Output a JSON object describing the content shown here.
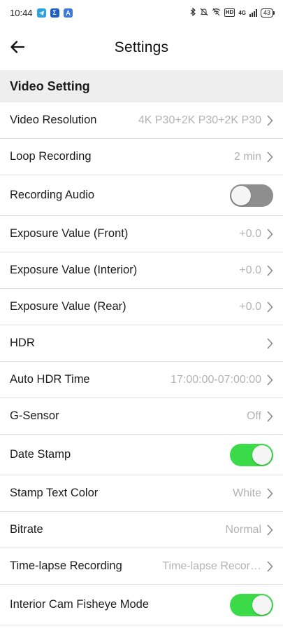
{
  "status_bar": {
    "time": "10:44",
    "battery": "43",
    "network": "4G",
    "hd_badge": "HD",
    "app_icons": [
      "telegram-icon",
      "sigma-app-icon",
      "antenna-app-icon"
    ]
  },
  "header": {
    "title": "Settings",
    "back_icon": "arrow-left-icon"
  },
  "section": {
    "title": "Video Setting"
  },
  "colors": {
    "toggle_on": "#3ada48",
    "toggle_off": "#8e8e8e",
    "value_text": "#b3b3b3",
    "section_bg": "#eeeeee"
  },
  "settings": [
    {
      "label": "Video Resolution",
      "value": "4K P30+2K P30+2K P30",
      "control": "chevron"
    },
    {
      "label": "Loop Recording",
      "value": "2 min",
      "control": "chevron"
    },
    {
      "label": "Recording Audio",
      "value": "",
      "control": "toggle",
      "state": "off"
    },
    {
      "label": "Exposure Value (Front)",
      "value": "+0.0",
      "control": "chevron"
    },
    {
      "label": "Exposure Value (Interior)",
      "value": "+0.0",
      "control": "chevron"
    },
    {
      "label": "Exposure Value (Rear)",
      "value": "+0.0",
      "control": "chevron"
    },
    {
      "label": "HDR",
      "value": "",
      "control": "chevron"
    },
    {
      "label": "Auto HDR Time",
      "value": "17:00:00-07:00:00",
      "control": "chevron"
    },
    {
      "label": "G-Sensor",
      "value": "Off",
      "control": "chevron"
    },
    {
      "label": "Date Stamp",
      "value": "",
      "control": "toggle",
      "state": "on"
    },
    {
      "label": "Stamp Text Color",
      "value": "White",
      "control": "chevron"
    },
    {
      "label": "Bitrate",
      "value": "Normal",
      "control": "chevron"
    },
    {
      "label": "Time-lapse Recording",
      "value": "Time-lapse Recor…",
      "control": "chevron"
    },
    {
      "label": "Interior Cam Fisheye Mode",
      "value": "",
      "control": "toggle",
      "state": "on"
    }
  ]
}
